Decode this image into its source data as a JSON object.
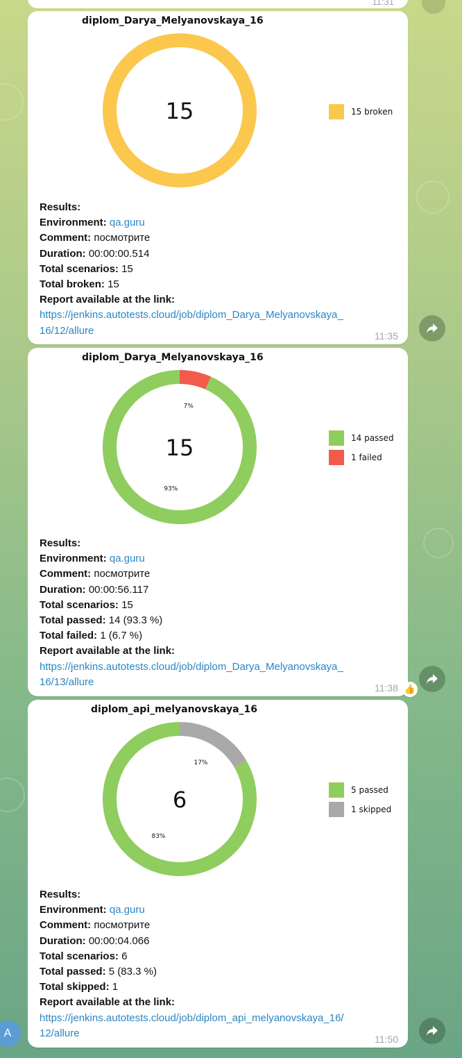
{
  "previous_message": {
    "time": "11:31"
  },
  "user": {
    "avatar_letter": "A"
  },
  "messages": [
    {
      "time": "11:35",
      "reaction": "",
      "chart_data": {
        "type": "pie",
        "title": "diplom_Darya_Melyanovskaya_16",
        "center_label": "15",
        "series": [
          {
            "name": "broken",
            "value": 15,
            "color": "#fbc74d",
            "legend": "15 broken",
            "percent_label": ""
          }
        ]
      },
      "results": {
        "heading": "Results:",
        "rows": [
          {
            "label": "Environment:",
            "value": "qa.guru"
          },
          {
            "label": "Comment:",
            "value": "посмотрите"
          },
          {
            "label": "Duration:",
            "value": "00:00:00.514"
          },
          {
            "label": "Total scenarios:",
            "value": "15"
          },
          {
            "label": "Total broken:",
            "value": "15"
          }
        ],
        "report_label": "Report available at the link:",
        "link_line1": "https://jenkins.autotests.cloud/job/diplom_Darya_Melyanovskaya_",
        "link_line2": "16/12/allure"
      }
    },
    {
      "time": "11:38",
      "reaction": "👍",
      "chart_data": {
        "type": "pie",
        "title": "diplom_Darya_Melyanovskaya_16",
        "center_label": "15",
        "series": [
          {
            "name": "failed",
            "value": 1,
            "color": "#f25b4b",
            "legend": "1 failed",
            "percent_label": "7%"
          },
          {
            "name": "passed",
            "value": 14,
            "color": "#8fcd5e",
            "legend": "14 passed",
            "percent_label": "93%"
          }
        ],
        "legend_order": [
          "passed",
          "failed"
        ]
      },
      "results": {
        "heading": "Results:",
        "rows": [
          {
            "label": "Environment:",
            "value": "qa.guru"
          },
          {
            "label": "Comment:",
            "value": "посмотрите"
          },
          {
            "label": "Duration:",
            "value": "00:00:56.117"
          },
          {
            "label": "Total scenarios:",
            "value": "15"
          },
          {
            "label": "Total passed:",
            "value": "14 (93.3 %)"
          },
          {
            "label": "Total failed:",
            "value": "1 (6.7 %)"
          }
        ],
        "report_label": "Report available at the link:",
        "link_line1": "https://jenkins.autotests.cloud/job/diplom_Darya_Melyanovskaya_",
        "link_line2": "16/13/allure"
      }
    },
    {
      "time": "11:50",
      "reaction": "",
      "chart_data": {
        "type": "pie",
        "title": "diplom_api_melyanovskaya_16",
        "center_label": "6",
        "series": [
          {
            "name": "skipped",
            "value": 1,
            "color": "#a9a9a9",
            "legend": "1 skipped",
            "percent_label": "17%"
          },
          {
            "name": "passed",
            "value": 5,
            "color": "#8fcd5e",
            "legend": "5 passed",
            "percent_label": "83%"
          }
        ],
        "legend_order": [
          "passed",
          "skipped"
        ]
      },
      "results": {
        "heading": "Results:",
        "rows": [
          {
            "label": "Environment:",
            "value": "qa.guru"
          },
          {
            "label": "Comment:",
            "value": "посмотрите"
          },
          {
            "label": "Duration:",
            "value": "00:00:04.066"
          },
          {
            "label": "Total scenarios:",
            "value": "6"
          },
          {
            "label": "Total passed:",
            "value": "5 (83.3 %)"
          },
          {
            "label": "Total skipped:",
            "value": "1"
          }
        ],
        "report_label": "Report available at the link:",
        "link_line1": "https://jenkins.autotests.cloud/job/diplom_api_melyanovskaya_16/",
        "link_line2": "12/allure"
      }
    }
  ]
}
